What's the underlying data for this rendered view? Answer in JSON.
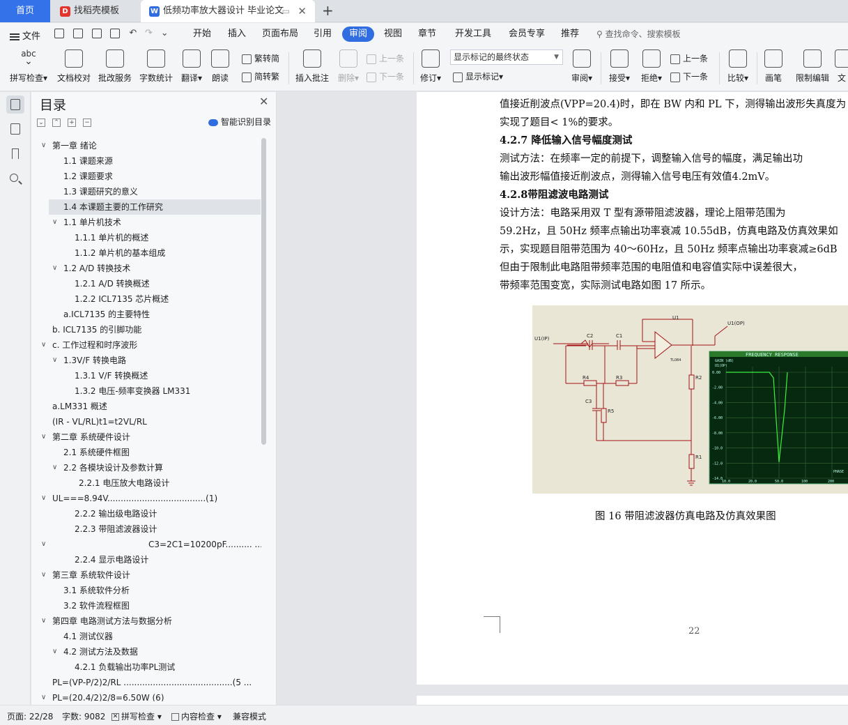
{
  "tabs": {
    "home": "首页",
    "t1": "找稻壳模板",
    "t2": "低频功率放大器设计 毕业论文"
  },
  "menu": {
    "file": "文件",
    "undo": "↶",
    "redo": "↷",
    "items": [
      "开始",
      "插入",
      "页面布局",
      "引用",
      "审阅",
      "视图",
      "章节",
      "开发工具",
      "会员专享",
      "推荐"
    ],
    "search": "查找命令、搜索模板"
  },
  "ribbon": {
    "spell": "拼写检查",
    "abc": "abc",
    "proof": "文档校对",
    "batch": "批改服务",
    "wordcount": "字数统计",
    "translate": "翻译",
    "read": "朗读",
    "trad": "繁转简",
    "simp": "简转繁",
    "insert_comment": "插入批注",
    "delete": "删除",
    "prev_comment": "上一条",
    "next_comment": "下一条",
    "revise": "修订",
    "display_state": "显示标记的最终状态",
    "show_marks": "显示标记",
    "review": "审阅",
    "accept": "接受",
    "reject": "拒绝",
    "prev_change": "上一条",
    "next_change": "下一条",
    "compare": "比较",
    "pen": "画笔",
    "restrict": "限制编辑",
    "doc_more": "文"
  },
  "toc": {
    "title": "目录",
    "smart": "智能识别目录",
    "items": [
      {
        "label": "第一章  绪论",
        "level": 0,
        "arrow": "∨"
      },
      {
        "label": "1.1 课题来源",
        "level": 1
      },
      {
        "label": "1.2 课题要求",
        "level": 1
      },
      {
        "label": "1.3 课题研究的意义",
        "level": 1
      },
      {
        "label": "1.4 本课题主要的工作研究",
        "level": 1,
        "selected": true
      },
      {
        "label": "1.1 单片机技术",
        "level": 1,
        "arrow": "∨"
      },
      {
        "label": "1.1.1 单片机的概述",
        "level": 2
      },
      {
        "label": "1.1.2 单片机的基本组成",
        "level": 2
      },
      {
        "label": "1.2 A/D 转换技术",
        "level": 1,
        "arrow": "∨"
      },
      {
        "label": "1.2.1 A/D 转换概述",
        "level": 2
      },
      {
        "label": "1.2.2 ICL7135 芯片概述",
        "level": 2
      },
      {
        "label": "a.ICL7135 的主要特性",
        "level": 1
      },
      {
        "label": "b. ICL7135 的引脚功能",
        "level": 0
      },
      {
        "label": "c.  工作过程和时序波形",
        "level": 0,
        "arrow": "∨"
      },
      {
        "label": "1.3V/F 转换电路",
        "level": 1,
        "arrow": "∨"
      },
      {
        "label": "1.3.1 V/F 转换概述",
        "level": 2
      },
      {
        "label": "1.3.2  电压-频率变换器 LM331",
        "level": 2
      },
      {
        "label": "a.LM331  概述",
        "level": 0
      },
      {
        "label": "(IR - VL/RL)t1=t2VL/RL",
        "level": 0
      },
      {
        "label": "第二章  系统硬件设计",
        "level": 0,
        "arrow": "∨"
      },
      {
        "label": "2.1  系统硬件框图",
        "level": 1
      },
      {
        "label": "2.2  各模块设计及参数计算",
        "level": 1,
        "arrow": "∨"
      },
      {
        "label": "2.2.1  电压放大电路设计",
        "level": 3
      },
      {
        "label": "UL===8.94V.....................................(1)",
        "level": 0,
        "arrow": "∨"
      },
      {
        "label": "2.2.2  输出级电路设计",
        "level": 2
      },
      {
        "label": "2.2.3  带阻滤波器设计",
        "level": 2
      },
      {
        "label": "C3=2C1=10200pF.......... ...",
        "level": 4,
        "arrow": "∨"
      },
      {
        "label": "2.2.4  显示电路设计",
        "level": 2
      },
      {
        "label": "第三章    系统软件设计",
        "level": 0,
        "arrow": "∨"
      },
      {
        "label": "3.1  系统软件分析",
        "level": 1
      },
      {
        "label": "3.2  软件流程框图",
        "level": 1
      },
      {
        "label": "第四章    电路测试方法与数据分析",
        "level": 0,
        "arrow": "∨"
      },
      {
        "label": "4.1  测试仪器",
        "level": 1
      },
      {
        "label": "4.2  测试方法及数据",
        "level": 1,
        "arrow": "∨"
      },
      {
        "label": "4.2.1  负载输出功率PL测试",
        "level": 2
      },
      {
        "label": "PL=(VP-P/2)2/RL .........................................(5 ...",
        "level": 0
      },
      {
        "label": "PL=(20.4/2)2/8=6.50W                                    (6)",
        "level": 0,
        "arrow": "∨"
      }
    ]
  },
  "document": {
    "lines": [
      {
        "text": "值接近削波点(VPP=20.4)时，即在 BW 内和 PL 下，测得输出波形失真度为",
        "bold": false
      },
      {
        "text": "实现了题目< 1%的要求。",
        "bold": false
      },
      {
        "text": "4.2.7 降低输入信号幅度测试",
        "bold": true
      },
      {
        "text": "    测试方法：在频率一定的前提下，调整输入信号的幅度，满足输出功",
        "bold": false
      },
      {
        "text": "输出波形幅值接近削波点，测得输入信号电压有效值4.2mV。",
        "bold": false
      },
      {
        "text": "4.2.8带阻滤波电路测试",
        "bold": true
      },
      {
        "text": "      设计方法：电路采用双 T 型有源带阻滤波器，理论上阻带范围为",
        "bold": false
      },
      {
        "text": "59.2Hz，且 50Hz 频率点输出功率衰减 10.55dB，仿真电路及仿真效果如",
        "bold": false
      },
      {
        "text": "示，实现题目阻带范围为 40～60Hz，且 50Hz 频率点输出功率衰减≥6dB",
        "bold": false
      },
      {
        "text": "      但由于限制此电路阻带频率范围的电阻值和电容值实际中误差很大，",
        "bold": false
      },
      {
        "text": "带频率范围变宽，实际测试电路如图 17 所示。",
        "bold": false
      }
    ],
    "caption": "图 16  带阻滤波器仿真电路及仿真效果图",
    "page_number": "22",
    "figure": {
      "u1": "U1",
      "c1": "C1",
      "c2": "C2",
      "c3": "C3",
      "r1": "R1",
      "r2": "R2",
      "r3": "R3",
      "r4": "R4",
      "r5": "R5",
      "opamp_model": "TL084",
      "graph_title": "FREQUENCY RESPONSE",
      "gain_label": "GAIN (dB)",
      "trace_label": "U1(OP)",
      "phase_label": "PHASE",
      "y_ticks": [
        "0.00",
        "-2.00",
        "-4.00",
        "-6.00",
        "-8.00",
        "-10.0",
        "-12.0",
        "-14.0"
      ],
      "x_ticks": [
        "10.0",
        "20.0",
        "50.0",
        "100",
        "200"
      ]
    }
  },
  "status": {
    "page": "页面: 22/28",
    "words": "字数: 9082",
    "spell": "拼写检查",
    "content": "内容检查",
    "compat": "兼容模式"
  },
  "colors": {
    "accent": "#2f6de1",
    "graph_bg": "#06290f",
    "trace": "#3cf23c"
  }
}
